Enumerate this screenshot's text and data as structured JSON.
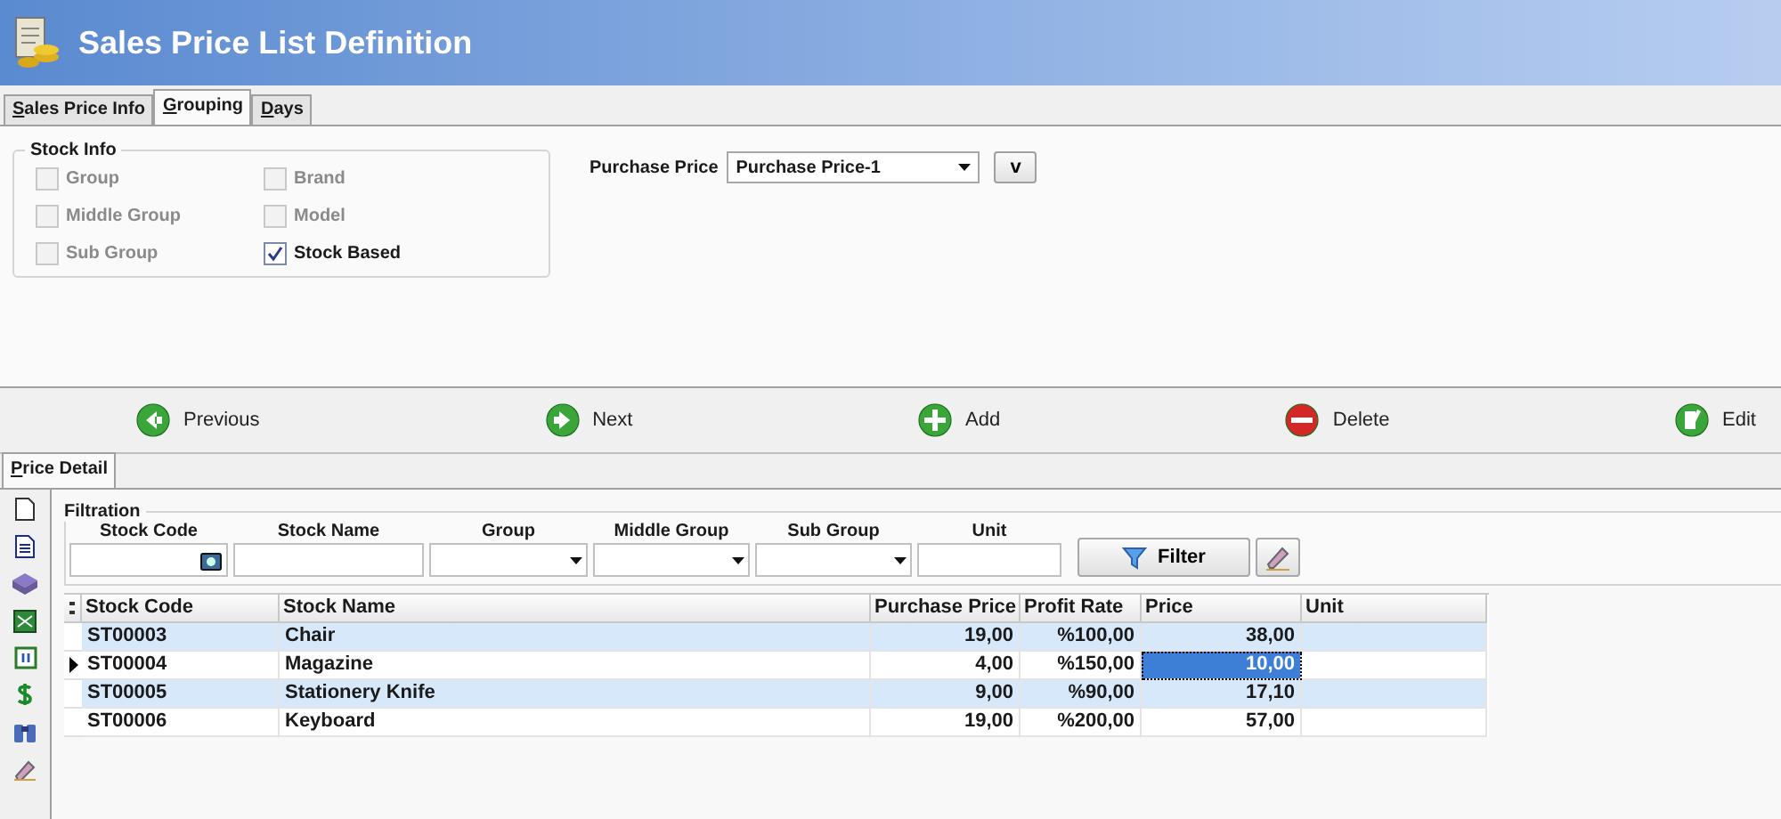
{
  "window": {
    "title": "Sales Price List Definition"
  },
  "tabs": [
    {
      "label": "Sales Price Info",
      "selected": false
    },
    {
      "label": "Grouping",
      "selected": true
    },
    {
      "label": "Days",
      "selected": false
    }
  ],
  "stock_info": {
    "title": "Stock Info",
    "options": [
      {
        "label": "Group",
        "checked": false,
        "disabled": true
      },
      {
        "label": "Brand",
        "checked": false,
        "disabled": true
      },
      {
        "label": "Middle Group",
        "checked": false,
        "disabled": true
      },
      {
        "label": "Model",
        "checked": false,
        "disabled": true
      },
      {
        "label": "Sub Group",
        "checked": false,
        "disabled": true
      },
      {
        "label": "Stock Based",
        "checked": true,
        "disabled": false
      }
    ]
  },
  "purchase_price": {
    "label": "Purchase Price",
    "value": "Purchase Price-1",
    "button": "v"
  },
  "toolbar": [
    {
      "kind": "previous",
      "label": "Previous"
    },
    {
      "kind": "next",
      "label": "Next"
    },
    {
      "kind": "add",
      "label": "Add"
    },
    {
      "kind": "delete",
      "label": "Delete"
    },
    {
      "kind": "edit",
      "label": "Edit"
    }
  ],
  "detail_tabs": [
    {
      "label": "Price Detail",
      "selected": true
    }
  ],
  "filtration": {
    "title": "Filtration",
    "fields": [
      {
        "kind": "lookup",
        "label": "Stock Code"
      },
      {
        "kind": "text",
        "label": "Stock Name"
      },
      {
        "kind": "dropdown",
        "label": "Group"
      },
      {
        "kind": "dropdown",
        "label": "Middle Group"
      },
      {
        "kind": "dropdown",
        "label": "Sub Group"
      },
      {
        "kind": "text",
        "label": "Unit"
      }
    ],
    "filter_button": "Filter"
  },
  "table": {
    "columns": [
      "Stock Code",
      "Stock Name",
      "Purchase Price",
      "Profit Rate",
      "Price",
      "Unit"
    ],
    "rows": [
      {
        "selected": false,
        "cells": [
          "ST00003",
          "Chair",
          "19,00",
          "%100,00",
          "38,00",
          ""
        ]
      },
      {
        "selected": true,
        "cells": [
          "ST00004",
          "Magazine",
          "4,00",
          "%150,00",
          "10,00",
          ""
        ]
      },
      {
        "selected": false,
        "cells": [
          "ST00005",
          "Stationery Knife",
          "9,00",
          "%90,00",
          "17,10",
          ""
        ]
      },
      {
        "selected": false,
        "cells": [
          "ST00006",
          "Keyboard",
          "19,00",
          "%200,00",
          "57,00",
          ""
        ]
      }
    ]
  }
}
